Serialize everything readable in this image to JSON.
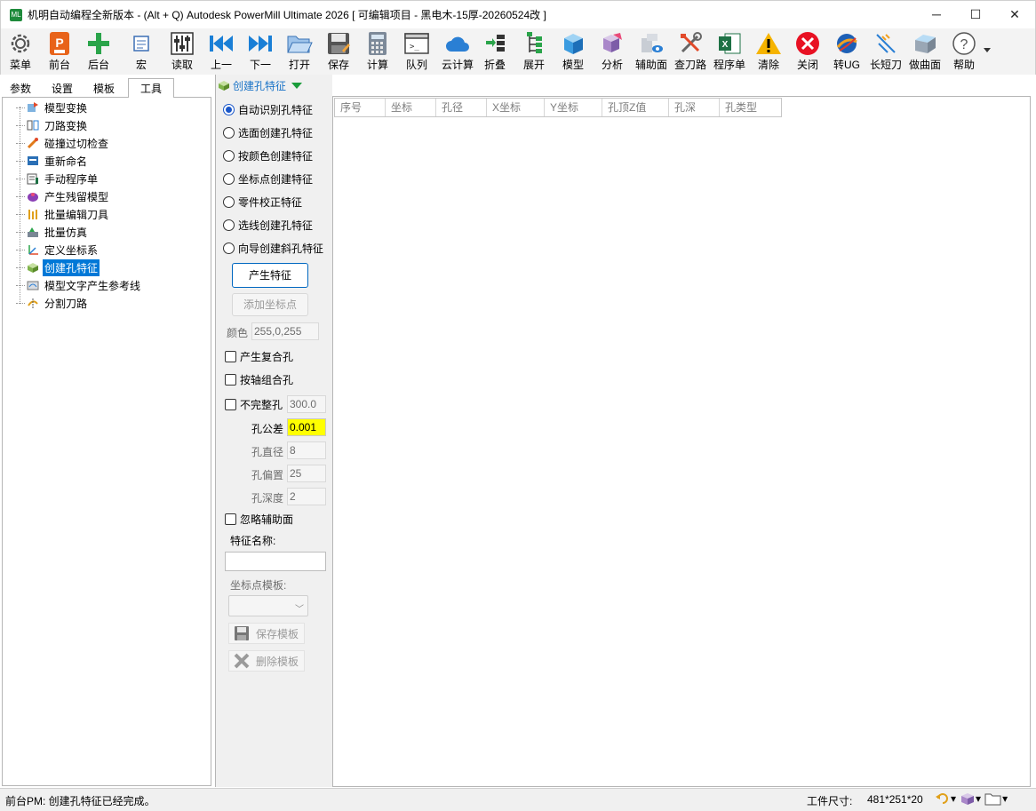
{
  "window": {
    "title": "机明自动编程全新版本 - (Alt + Q) Autodesk PowerMill Ultimate 2026    [ 可编辑项目 - 黑电木-15厚-20260524改 ]",
    "minimize": "─",
    "maximize": "☐",
    "close": "✕"
  },
  "toolbar": {
    "items": [
      {
        "label": "菜单",
        "icon": "gear-icon"
      },
      {
        "label": "前台",
        "icon": "powermill-icon"
      },
      {
        "label": "后台",
        "icon": "plus-icon"
      },
      {
        "label": "宏",
        "icon": "macro-icon"
      },
      {
        "label": "读取",
        "icon": "sliders-icon"
      },
      {
        "label": "上一",
        "icon": "prev-icon"
      },
      {
        "label": "下一",
        "icon": "next-icon"
      },
      {
        "label": "打开",
        "icon": "folder-open-icon"
      },
      {
        "label": "保存",
        "icon": "save-icon"
      },
      {
        "label": "计算",
        "icon": "calculator-icon"
      },
      {
        "label": "队列",
        "icon": "console-icon"
      },
      {
        "label": "云计算",
        "icon": "cloud-icon"
      },
      {
        "label": "折叠",
        "icon": "collapse-icon"
      },
      {
        "label": "展开",
        "icon": "expand-tree-icon"
      },
      {
        "label": "模型",
        "icon": "cube-icon"
      },
      {
        "label": "分析",
        "icon": "analysis-icon"
      },
      {
        "label": "辅助面",
        "icon": "aux-surface-icon"
      },
      {
        "label": "查刀路",
        "icon": "tools-icon"
      },
      {
        "label": "程序单",
        "icon": "excel-icon"
      },
      {
        "label": "清除",
        "icon": "warning-icon"
      },
      {
        "label": "关闭",
        "icon": "close-circle-icon"
      },
      {
        "label": "转UG",
        "icon": "ug-icon"
      },
      {
        "label": "长短刀",
        "icon": "long-short-tool-icon"
      },
      {
        "label": "做曲面",
        "icon": "surface-icon"
      },
      {
        "label": "帮助",
        "icon": "help-icon"
      }
    ]
  },
  "tabs": [
    {
      "label": "参数"
    },
    {
      "label": "设置"
    },
    {
      "label": "模板"
    },
    {
      "label": "工具"
    }
  ],
  "tree": {
    "items": [
      {
        "label": "模型变换"
      },
      {
        "label": "刀路变换"
      },
      {
        "label": "碰撞过切检查"
      },
      {
        "label": "重新命名"
      },
      {
        "label": "手动程序单"
      },
      {
        "label": "产生残留模型"
      },
      {
        "label": "批量编辑刀具"
      },
      {
        "label": "批量仿真"
      },
      {
        "label": "定义坐标系"
      },
      {
        "label": "创建孔特征"
      },
      {
        "label": "模型文字产生参考线"
      },
      {
        "label": "分割刀路"
      }
    ]
  },
  "panel": {
    "title": "创建孔特征",
    "options": [
      {
        "label": "自动识别孔特征"
      },
      {
        "label": "选面创建孔特征"
      },
      {
        "label": "按颜色创建特征"
      },
      {
        "label": "坐标点创建特征"
      },
      {
        "label": "零件校正特征"
      },
      {
        "label": "选线创建孔特征"
      },
      {
        "label": "向导创建斜孔特征"
      }
    ],
    "generate_button": "产生特征",
    "add_point_button": "添加坐标点",
    "color_label": "颜色",
    "color_value": "255,0,255",
    "compound_hole": "产生复合孔",
    "axis_group": "按轴组合孔",
    "incomplete_hole": "不完整孔",
    "incomplete_value": "300.0",
    "tolerance_label": "孔公差",
    "tolerance_value": "0.001",
    "diameter_label": "孔直径",
    "diameter_value": "8",
    "offset_label": "孔偏置",
    "offset_value": "25",
    "depth_label": "孔深度",
    "depth_value": "2",
    "ignore_aux": "忽略辅助面",
    "feature_name_label": "特征名称:",
    "feature_name_value": "",
    "template_label": "坐标点模板:",
    "save_template": "保存模板",
    "delete_template": "删除模板"
  },
  "grid": {
    "columns": [
      "序号",
      "坐标",
      "孔径",
      "X坐标",
      "Y坐标",
      "孔顶Z值",
      "孔深",
      "孔类型"
    ]
  },
  "status": {
    "message": "前台PM: 创建孔特征已经完成。",
    "size_label": "工件尺寸:",
    "size_value": "481*251*20"
  }
}
